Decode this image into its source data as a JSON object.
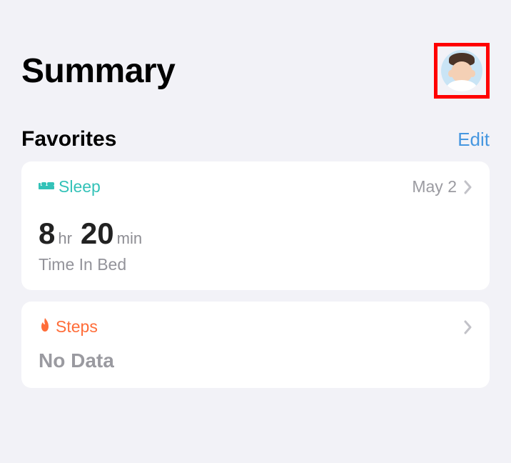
{
  "header": {
    "title": "Summary"
  },
  "favorites": {
    "title": "Favorites",
    "edit_label": "Edit"
  },
  "cards": {
    "sleep": {
      "category": "Sleep",
      "date": "May 2",
      "hours": "8",
      "hours_unit": "hr",
      "minutes": "20",
      "minutes_unit": "min",
      "subtitle": "Time In Bed",
      "color": "#33c2b8"
    },
    "steps": {
      "category": "Steps",
      "value": "No Data",
      "color": "#ff6d39"
    }
  }
}
